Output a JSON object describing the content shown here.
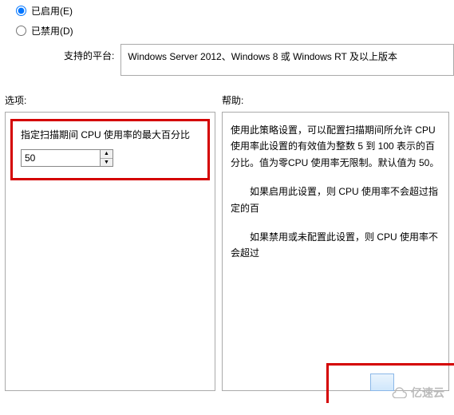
{
  "radios": {
    "enabled": "已启用(E)",
    "disabled": "已禁用(D)"
  },
  "platform": {
    "label": "支持的平台:",
    "value": "Windows Server 2012、Windows 8 或 Windows RT 及以上版本"
  },
  "sections": {
    "options": "选项:",
    "help": "帮助:"
  },
  "option": {
    "label": "指定扫描期间 CPU 使用率的最大百分比",
    "value": "50"
  },
  "help": {
    "p1": "使用此策略设置，可以配置扫描期间所允许 CPU 使用率此设置的有效值为整数 5 到 100 表示的百分比。值为零CPU 使用率无限制。默认值为 50。",
    "p2": "如果启用此设置，则 CPU 使用率不会超过指定的百",
    "p3": "如果禁用或未配置此设置，则 CPU 使用率不会超过"
  },
  "watermark": "亿速云"
}
